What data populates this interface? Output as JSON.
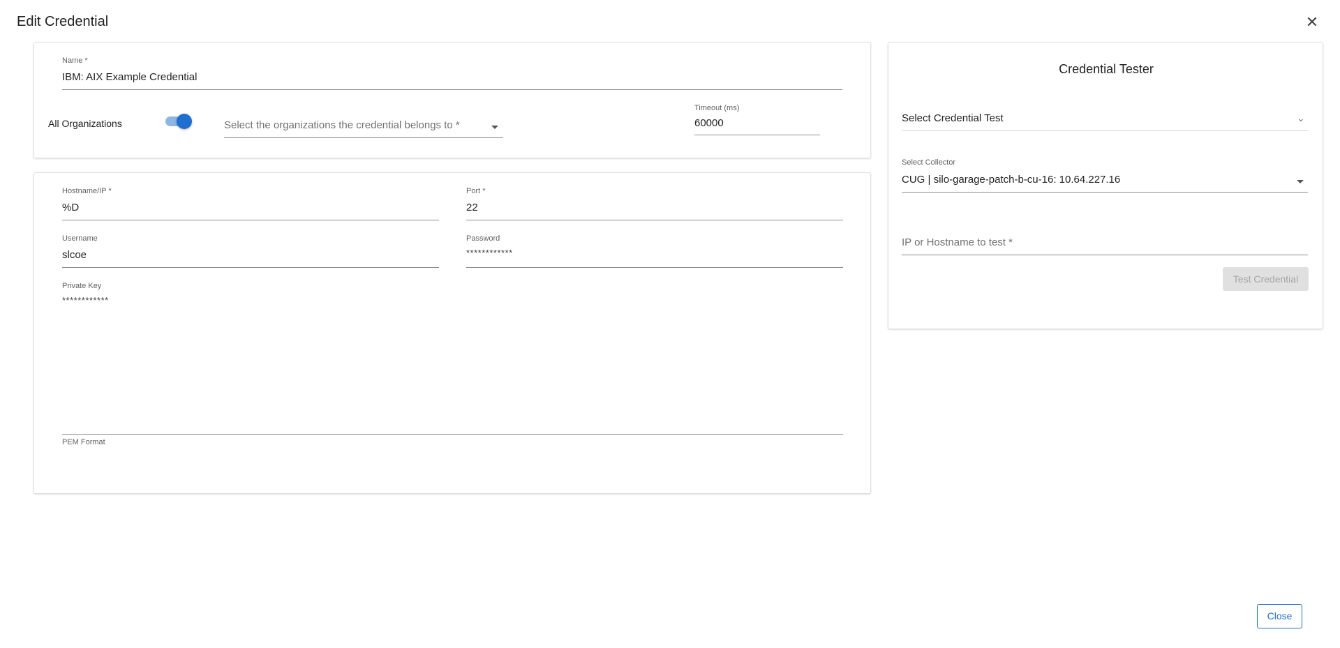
{
  "dialog": {
    "title": "Edit Credential",
    "close_icon": "close-icon"
  },
  "general": {
    "name_label": "Name *",
    "name_value": "IBM: AIX Example Credential",
    "all_orgs_label": "All Organizations",
    "all_orgs_enabled": true,
    "orgs_placeholder": "Select the organizations the credential belongs to *",
    "timeout_label": "Timeout (ms)",
    "timeout_value": "60000"
  },
  "connection": {
    "hostname_label": "Hostname/IP *",
    "hostname_value": "%D",
    "port_label": "Port *",
    "port_value": "22",
    "username_label": "Username",
    "username_value": "slcoe",
    "password_label": "Password",
    "password_value": "************",
    "private_key_label": "Private Key",
    "private_key_value": "************",
    "private_key_helper": "PEM Format"
  },
  "tester": {
    "title": "Credential Tester",
    "test_select_placeholder": "Select Credential Test",
    "collector_label": "Select Collector",
    "collector_value": "CUG | silo-garage-patch-b-cu-16: 10.64.227.16",
    "ip_placeholder": "IP or Hostname to test *",
    "test_button": "Test Credential"
  },
  "footer": {
    "close_button": "Close"
  },
  "colors": {
    "accent": "#1f6fd1",
    "toggle_track": "#8fb6e3",
    "disabled_bg": "#e0e0e0"
  }
}
